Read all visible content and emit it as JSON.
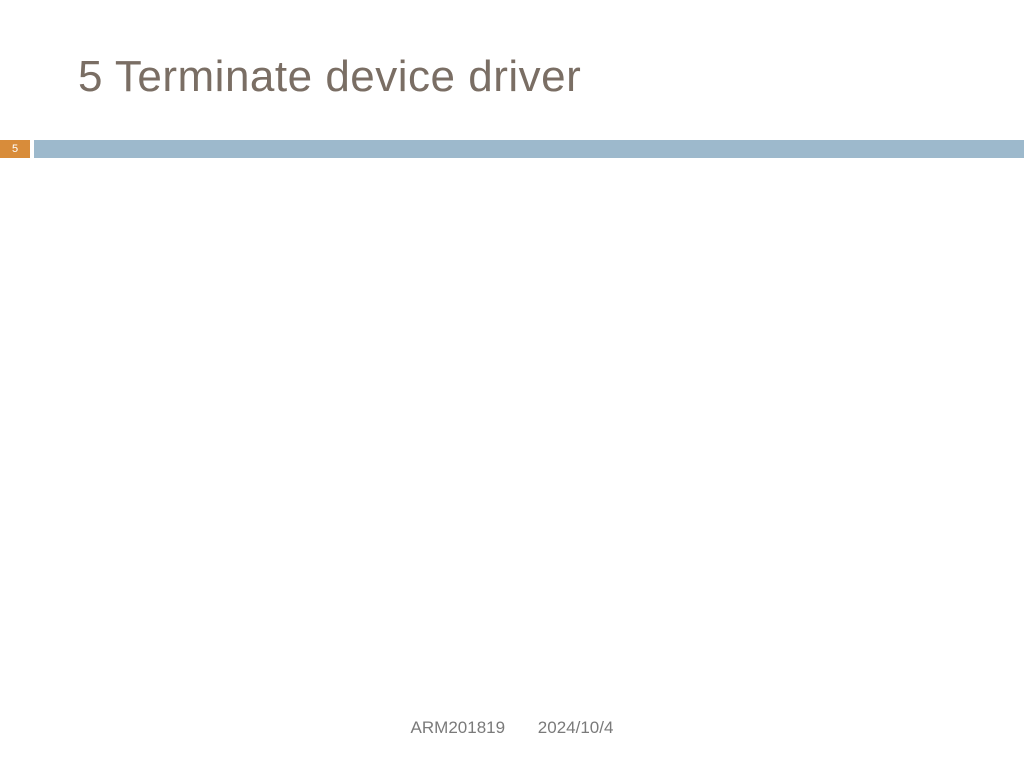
{
  "slide": {
    "title": "5 Terminate device driver",
    "page_number": "5"
  },
  "footer": {
    "course": "ARM201819",
    "date": "2024/10/4"
  },
  "colors": {
    "title_text": "#7a6e64",
    "badge_bg": "#d88c3a",
    "divider_bg": "#9db9cc",
    "footer_text": "#7a7a7a"
  }
}
